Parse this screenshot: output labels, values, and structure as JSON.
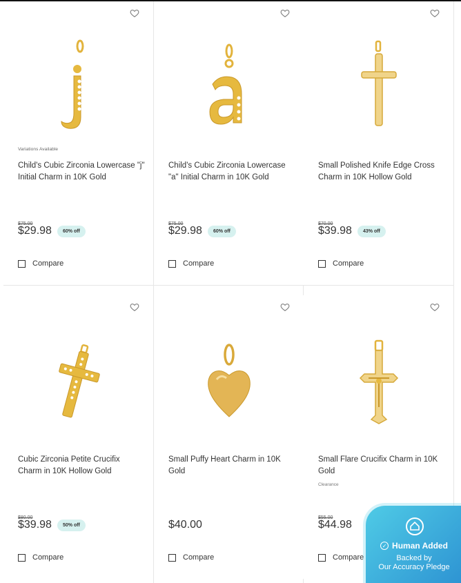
{
  "products": [
    {
      "variations": "Variations Available",
      "name": "Child's Cubic Zirconia Lowercase \"j\" Initial Charm in 10K Gold",
      "tag": "",
      "original_price": "$75.00",
      "price": "$29.98",
      "discount": "60% off",
      "compare_label": "Compare",
      "image_icon": "letter-j-charm-icon"
    },
    {
      "variations": "",
      "name": "Child's Cubic Zirconia Lowercase \"a\" Initial Charm in 10K Gold",
      "tag": "",
      "original_price": "$75.00",
      "price": "$29.98",
      "discount": "60% off",
      "compare_label": "Compare",
      "image_icon": "letter-a-charm-icon"
    },
    {
      "variations": "",
      "name": "Small Polished Knife Edge Cross Charm in 10K Hollow Gold",
      "tag": "",
      "original_price": "$70.00",
      "price": "$39.98",
      "discount": "43% off",
      "compare_label": "Compare",
      "image_icon": "cross-charm-icon"
    },
    {
      "variations": "",
      "name": "Cubic Zirconia Petite Crucifix Charm in 10K Hollow Gold",
      "tag": "",
      "original_price": "$80.00",
      "price": "$39.98",
      "discount": "50% off",
      "compare_label": "Compare",
      "image_icon": "cz-cross-charm-icon"
    },
    {
      "variations": "",
      "name": "Small Puffy Heart Charm in 10K Gold",
      "tag": "",
      "original_price": "",
      "price": "$40.00",
      "discount": "",
      "compare_label": "Compare",
      "image_icon": "heart-charm-icon"
    },
    {
      "variations": "",
      "name": "Small Flare Crucifix Charm in 10K Gold",
      "tag": "Clearance",
      "original_price": "$55.00",
      "price": "$44.98",
      "discount": "",
      "compare_label": "Compare",
      "image_icon": "crucifix-charm-icon"
    }
  ],
  "pledge": {
    "title": "Human Added",
    "line1": "Backed by",
    "line2": "Our Accuracy Pledge",
    "icon": "home-badge-icon"
  },
  "colors": {
    "gold": "#e6b93f",
    "badge_bg": "#d6f1ef",
    "pledge_start": "#4fcbe6",
    "pledge_end": "#2b8fd1"
  }
}
